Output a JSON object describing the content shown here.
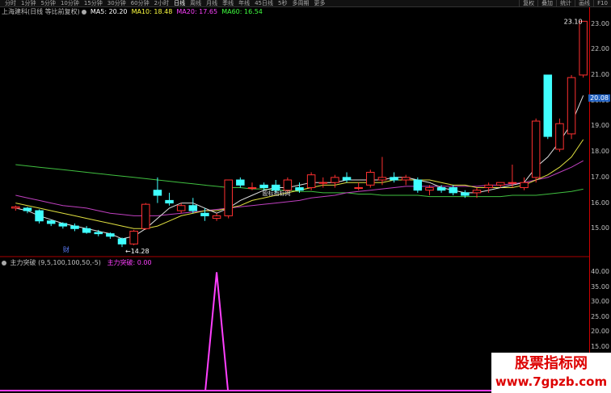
{
  "toolbar": {
    "periods": [
      "分时",
      "1分钟",
      "5分钟",
      "10分钟",
      "15分钟",
      "30分钟",
      "60分钟",
      "2小时",
      "日线",
      "周线",
      "月线",
      "季线",
      "年线",
      "45日线",
      "5秒",
      "多周期",
      "更多"
    ],
    "active_period": 8,
    "right_buttons": [
      "复权",
      "叠加",
      "统计",
      "画线",
      "F10"
    ]
  },
  "main_panel": {
    "stock_title": "上海建科(日线 等比前复权)",
    "ma": [
      {
        "label": "MA5: 20.20",
        "color": "#ffffff"
      },
      {
        "label": "MA10: 18.48",
        "color": "#ffff40"
      },
      {
        "label": "MA20: 17.65",
        "color": "#ff40ff"
      },
      {
        "label": "MA60: 16.54",
        "color": "#40ff40"
      }
    ],
    "price_ticks": [
      "23.00",
      "22.00",
      "21.00",
      "20.00",
      "19.00",
      "18.00",
      "17.00",
      "16.00",
      "15.00"
    ],
    "current_price": "20.08",
    "high_label": "23.10",
    "low_label": "14.28",
    "chart_watermark": "股标指标网",
    "fin_badge": "财"
  },
  "indicator_panel": {
    "name": "主力突破 (9,5,100,100,50,-5)",
    "value_label": "主力突破: 0.00",
    "ticks": [
      "40.00",
      "35.00",
      "30.00",
      "25.00",
      "20.00",
      "15.00",
      "10.00",
      "5.00"
    ]
  },
  "watermark": {
    "line1": "股票指标网",
    "line2": "www.7gpzb.com"
  },
  "chart_data": [
    {
      "type": "candlestick",
      "ylim": [
        14.0,
        23.3
      ],
      "candles": [
        [
          15.8,
          15.9,
          15.7,
          15.85
        ],
        [
          15.8,
          15.85,
          15.6,
          15.7
        ],
        [
          15.7,
          15.75,
          15.2,
          15.3
        ],
        [
          15.3,
          15.35,
          15.1,
          15.2
        ],
        [
          15.2,
          15.25,
          15.0,
          15.1
        ],
        [
          15.1,
          15.2,
          14.9,
          15.0
        ],
        [
          15.0,
          15.1,
          14.8,
          14.85
        ],
        [
          14.85,
          14.95,
          14.7,
          14.8
        ],
        [
          14.8,
          14.85,
          14.6,
          14.7
        ],
        [
          14.6,
          14.65,
          14.28,
          14.4
        ],
        [
          14.4,
          14.95,
          14.35,
          14.9
        ],
        [
          15.0,
          16.0,
          14.95,
          15.95
        ],
        [
          16.5,
          17.0,
          16.0,
          16.3
        ],
        [
          16.1,
          16.4,
          15.9,
          16.0
        ],
        [
          15.7,
          16.0,
          15.6,
          15.9
        ],
        [
          15.9,
          16.2,
          15.6,
          15.7
        ],
        [
          15.6,
          15.8,
          15.3,
          15.5
        ],
        [
          15.4,
          15.6,
          15.3,
          15.5
        ],
        [
          15.5,
          16.9,
          15.4,
          16.9
        ],
        [
          16.9,
          17.0,
          16.6,
          16.7
        ],
        [
          16.6,
          16.8,
          16.5,
          16.6
        ],
        [
          16.7,
          16.8,
          16.5,
          16.6
        ],
        [
          16.7,
          16.9,
          16.4,
          16.5
        ],
        [
          16.5,
          17.0,
          16.4,
          16.9
        ],
        [
          16.6,
          16.8,
          16.4,
          16.5
        ],
        [
          16.6,
          17.2,
          16.5,
          17.1
        ],
        [
          16.8,
          17.0,
          16.6,
          16.8
        ],
        [
          16.8,
          17.1,
          16.6,
          17.0
        ],
        [
          17.0,
          17.2,
          16.8,
          16.9
        ],
        [
          16.6,
          16.8,
          16.5,
          16.6
        ],
        [
          16.7,
          17.3,
          16.6,
          17.2
        ],
        [
          16.9,
          17.8,
          16.7,
          17.0
        ],
        [
          17.0,
          17.2,
          16.8,
          16.9
        ],
        [
          16.9,
          17.1,
          16.7,
          17.0
        ],
        [
          16.9,
          17.0,
          16.4,
          16.5
        ],
        [
          16.5,
          16.7,
          16.3,
          16.6
        ],
        [
          16.6,
          16.7,
          16.4,
          16.5
        ],
        [
          16.6,
          16.7,
          16.3,
          16.4
        ],
        [
          16.4,
          16.5,
          16.2,
          16.3
        ],
        [
          16.4,
          16.6,
          16.2,
          16.5
        ],
        [
          16.6,
          16.8,
          16.4,
          16.7
        ],
        [
          16.7,
          16.8,
          16.6,
          16.8
        ],
        [
          16.8,
          17.5,
          16.6,
          16.8
        ],
        [
          16.6,
          17.0,
          16.5,
          16.8
        ],
        [
          17.0,
          19.3,
          16.8,
          19.2
        ],
        [
          21.0,
          21.0,
          18.5,
          18.6
        ],
        [
          18.1,
          19.3,
          18.0,
          19.1
        ],
        [
          18.7,
          21.0,
          18.5,
          20.9
        ],
        [
          21.0,
          23.1,
          20.9,
          23.1
        ]
      ],
      "ma5": [
        15.8,
        15.7,
        15.5,
        15.35,
        15.2,
        15.1,
        15.0,
        14.9,
        14.8,
        14.6,
        14.7,
        15.0,
        15.4,
        15.8,
        16.0,
        16.0,
        15.8,
        15.6,
        15.8,
        16.1,
        16.3,
        16.5,
        16.6,
        16.6,
        16.7,
        16.8,
        16.8,
        16.8,
        16.9,
        16.9,
        16.9,
        16.9,
        17.0,
        17.0,
        16.9,
        16.8,
        16.6,
        16.5,
        16.4,
        16.4,
        16.5,
        16.6,
        16.7,
        16.8,
        17.4,
        17.8,
        18.4,
        19.1,
        20.2
      ],
      "ma10": [
        16.0,
        15.9,
        15.8,
        15.7,
        15.6,
        15.5,
        15.4,
        15.3,
        15.2,
        15.1,
        15.0,
        15.0,
        15.1,
        15.3,
        15.5,
        15.6,
        15.7,
        15.7,
        15.8,
        15.9,
        16.1,
        16.2,
        16.3,
        16.4,
        16.5,
        16.6,
        16.7,
        16.7,
        16.8,
        16.8,
        16.8,
        16.8,
        16.9,
        16.9,
        16.9,
        16.9,
        16.8,
        16.7,
        16.7,
        16.6,
        16.6,
        16.6,
        16.6,
        16.7,
        16.9,
        17.1,
        17.4,
        17.8,
        18.48
      ],
      "ma20": [
        16.3,
        16.2,
        16.1,
        16.0,
        15.9,
        15.85,
        15.8,
        15.7,
        15.6,
        15.55,
        15.5,
        15.5,
        15.5,
        15.55,
        15.6,
        15.65,
        15.7,
        15.75,
        15.8,
        15.85,
        15.9,
        15.95,
        16.0,
        16.05,
        16.1,
        16.2,
        16.25,
        16.3,
        16.4,
        16.45,
        16.5,
        16.55,
        16.6,
        16.65,
        16.65,
        16.65,
        16.65,
        16.65,
        16.65,
        16.65,
        16.7,
        16.7,
        16.75,
        16.8,
        16.9,
        17.0,
        17.2,
        17.4,
        17.65
      ],
      "ma60": [
        17.5,
        17.45,
        17.4,
        17.35,
        17.3,
        17.25,
        17.2,
        17.15,
        17.1,
        17.05,
        17.0,
        16.95,
        16.9,
        16.85,
        16.8,
        16.75,
        16.7,
        16.65,
        16.6,
        16.6,
        16.55,
        16.55,
        16.5,
        16.5,
        16.45,
        16.45,
        16.4,
        16.4,
        16.4,
        16.35,
        16.35,
        16.3,
        16.3,
        16.3,
        16.3,
        16.25,
        16.25,
        16.25,
        16.25,
        16.25,
        16.25,
        16.25,
        16.3,
        16.3,
        16.3,
        16.35,
        16.4,
        16.45,
        16.54
      ]
    },
    {
      "type": "line",
      "name": "主力突破",
      "ylim": [
        0,
        42
      ],
      "spike_index": 17,
      "spike_value": 40,
      "values_default": 0
    }
  ]
}
